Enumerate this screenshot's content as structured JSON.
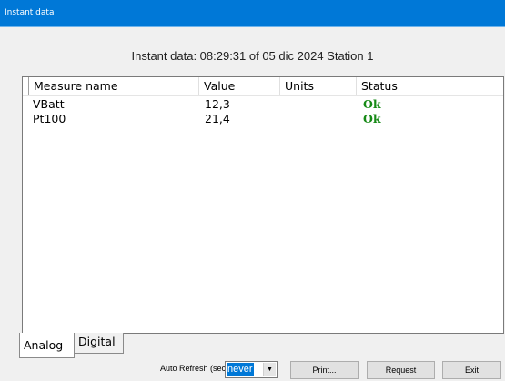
{
  "window": {
    "title": "Instant data"
  },
  "header": {
    "text": "Instant data:  08:29:31 of 05 dic 2024 Station 1"
  },
  "table": {
    "columns": [
      "Measure name",
      "Value",
      "Units",
      "Status"
    ],
    "rows": [
      {
        "name": "VBatt",
        "value": "12,3",
        "units": "",
        "status": "Ok"
      },
      {
        "name": "Pt100",
        "value": "21,4",
        "units": "",
        "status": "Ok"
      }
    ]
  },
  "tabs": [
    {
      "label": "Analog",
      "active": true
    },
    {
      "label": "Digital",
      "active": false
    }
  ],
  "footer": {
    "auto_refresh_label": "Auto Refresh (sec):",
    "auto_refresh_value": "never",
    "print_label": "Print...",
    "request_label": "Request",
    "exit_label": "Exit"
  },
  "colors": {
    "titlebar": "#0078d7",
    "status_ok": "#178a17"
  },
  "icons": {
    "dropdown": "chevron-down-icon"
  }
}
